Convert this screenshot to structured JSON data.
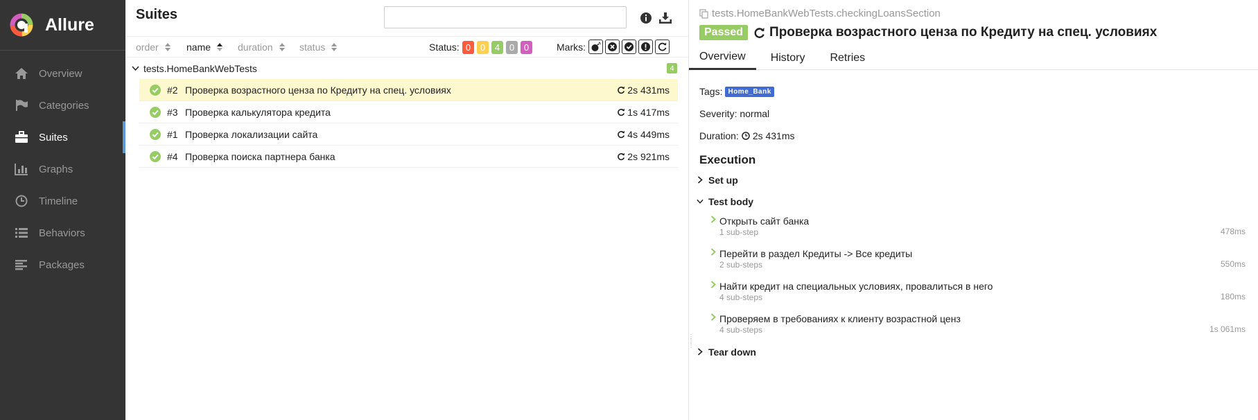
{
  "brand": {
    "name": "Allure"
  },
  "sidebar": {
    "items": [
      {
        "label": "Overview",
        "icon": "home-icon"
      },
      {
        "label": "Categories",
        "icon": "flag-icon"
      },
      {
        "label": "Suites",
        "icon": "briefcase-icon",
        "active": true
      },
      {
        "label": "Graphs",
        "icon": "bar-chart-icon"
      },
      {
        "label": "Timeline",
        "icon": "clock-icon"
      },
      {
        "label": "Behaviors",
        "icon": "list-icon"
      },
      {
        "label": "Packages",
        "icon": "align-left-icon"
      }
    ]
  },
  "suites": {
    "title": "Suites",
    "search_value": "",
    "sort": {
      "order": "order",
      "name": "name",
      "duration": "duration",
      "status": "status"
    },
    "status_label": "Status:",
    "status_counts": [
      {
        "value": "0",
        "color": "#fd5a3e"
      },
      {
        "value": "0",
        "color": "#ffd050"
      },
      {
        "value": "4",
        "color": "#97cc64"
      },
      {
        "value": "0",
        "color": "#aaaaaa"
      },
      {
        "value": "0",
        "color": "#d35ebe"
      }
    ],
    "marks_label": "Marks:",
    "group": {
      "name": "tests.HomeBankWebTests",
      "count": "4"
    },
    "tests": [
      {
        "num": "#2",
        "name": "Проверка возрастного ценза по Кредиту на спец. условиях",
        "duration": "2s 431ms",
        "selected": true
      },
      {
        "num": "#3",
        "name": "Проверка калькулятора кредита",
        "duration": "1s 417ms"
      },
      {
        "num": "#1",
        "name": "Проверка локализации сайта",
        "duration": "4s 449ms"
      },
      {
        "num": "#4",
        "name": "Проверка поиска партнера банка",
        "duration": "2s 921ms"
      }
    ]
  },
  "detail": {
    "path": "tests.HomeBankWebTests.checkingLoansSection",
    "status": "Passed",
    "title": "Проверка возрастного ценза по Кредиту на спец. условиях",
    "tabs": [
      "Overview",
      "History",
      "Retries"
    ],
    "tags_label": "Tags:",
    "tag": "Home_Bank",
    "severity": "Severity: normal",
    "duration_label": "Duration:",
    "duration": "2s 431ms",
    "execution_title": "Execution",
    "setup": "Set up",
    "test_body": "Test body",
    "teardown": "Tear down",
    "steps": [
      {
        "name": "Открыть сайт банка",
        "sub": "1 sub-step",
        "duration": "478ms"
      },
      {
        "name": "Перейти в раздел Кредиты -> Все кредиты",
        "sub": "2 sub-steps",
        "duration": "550ms"
      },
      {
        "name": "Найти кредит на специальных условиях, провалиться в него",
        "sub": "4 sub-steps",
        "duration": "180ms"
      },
      {
        "name": "Проверяем в требованиях к клиенту возрастной ценз",
        "sub": "4 sub-steps",
        "duration": "1s 061ms"
      }
    ]
  }
}
